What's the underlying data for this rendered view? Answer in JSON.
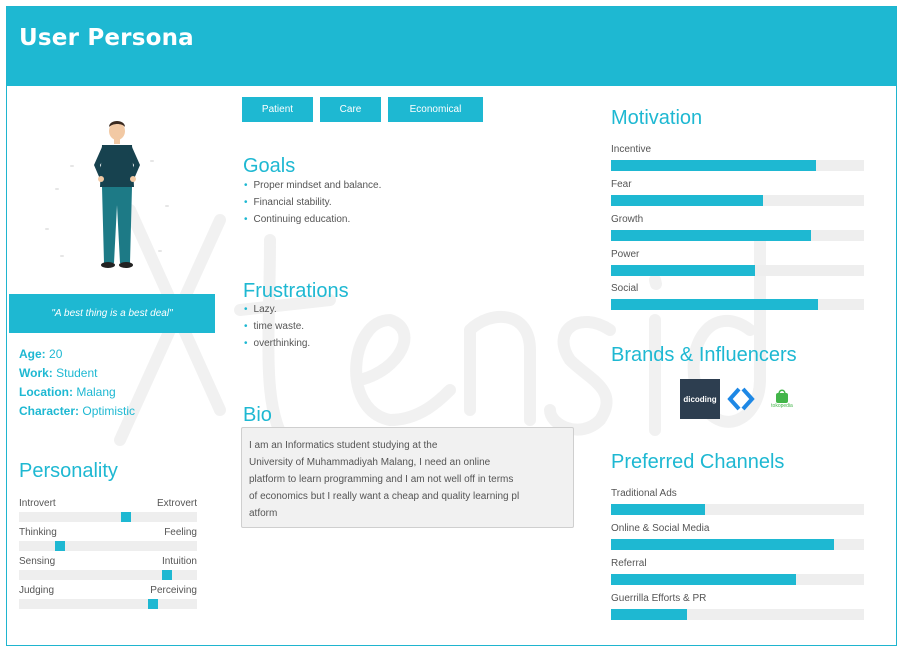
{
  "header": {
    "title": "User Persona"
  },
  "quote": "\"A best thing is a best deal\"",
  "profile": [
    {
      "key": "Age:",
      "value": "20"
    },
    {
      "key": "Work:",
      "value": "Student"
    },
    {
      "key": "Location:",
      "value": "Malang"
    },
    {
      "key": "Character:",
      "value": "Optimistic"
    }
  ],
  "personality": {
    "title": "Personality",
    "traits": [
      {
        "left": "Introvert",
        "right": "Extrovert",
        "level": 0.6
      },
      {
        "left": "Thinking",
        "right": "Feeling",
        "level": 0.23
      },
      {
        "left": "Sensing",
        "right": "Intuition",
        "level": 0.83
      },
      {
        "left": "Judging",
        "right": "Perceiving",
        "level": 0.75
      }
    ]
  },
  "tags": [
    "Patient",
    "Care",
    "Economical"
  ],
  "goals": {
    "title": "Goals",
    "items": [
      "Proper mindset and balance.",
      "Financial stability.",
      "Continuing education."
    ]
  },
  "frustrations": {
    "title": "Frustrations",
    "items": [
      "Lazy.",
      "time waste.",
      "overthinking."
    ]
  },
  "bio": {
    "title": "Bio",
    "text": "I am an Informatics student studying at the\nUniversity of Muhammadiyah Malang, I need an online\nplatform to learn programming and I am not well off in terms\nof economics but I really want a cheap and quality learning pl\natform"
  },
  "motivation": {
    "title": "Motivation",
    "items": [
      {
        "label": "Incentive",
        "level": 0.81
      },
      {
        "label": "Fear",
        "level": 0.6
      },
      {
        "label": "Growth",
        "level": 0.79
      },
      {
        "label": "Power",
        "level": 0.57
      },
      {
        "label": "Social",
        "level": 0.82
      }
    ]
  },
  "brands": {
    "title": "Brands & Influencers",
    "logos": [
      "dicoding",
      "tokopedia"
    ],
    "colors": {
      "dicoding_bg": "#2d3e50",
      "dicoding_mark": "#1e88e5",
      "tokopedia": "#42b549"
    }
  },
  "channels": {
    "title": "Preferred Channels",
    "items": [
      {
        "label": "Traditional Ads",
        "level": 0.37
      },
      {
        "label": "Online & Social Media",
        "level": 0.88
      },
      {
        "label": "Referral",
        "level": 0.73
      },
      {
        "label": "Guerrilla Efforts & PR",
        "level": 0.3
      }
    ]
  },
  "colors": {
    "accent": "#1eb8d2",
    "track": "#eeeeee"
  }
}
